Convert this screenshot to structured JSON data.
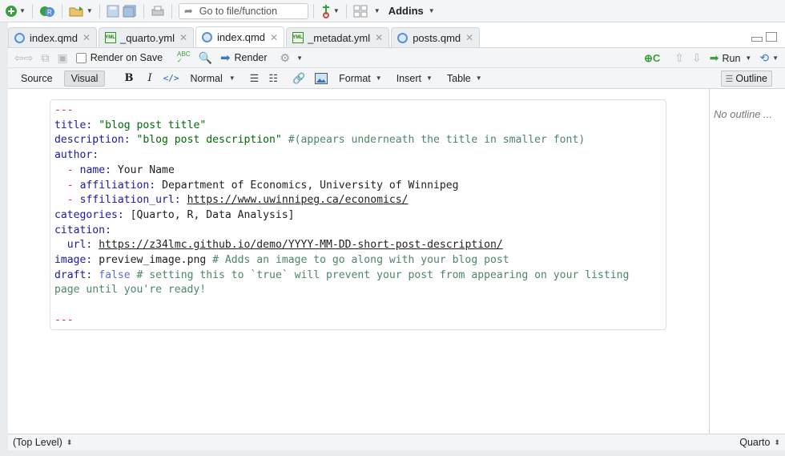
{
  "toolbar": {
    "goto_placeholder": "Go to file/function",
    "addins_label": "Addins"
  },
  "tabs": [
    {
      "label": "index.qmd",
      "icon": "quarto-file-icon",
      "active": false
    },
    {
      "label": "_quarto.yml",
      "icon": "yaml-file-icon",
      "active": false
    },
    {
      "label": "index.qmd",
      "icon": "quarto-file-icon",
      "active": true
    },
    {
      "label": "_metadat.yml",
      "icon": "yaml-file-icon",
      "active": false
    },
    {
      "label": "posts.qmd",
      "icon": "quarto-file-icon",
      "active": false
    }
  ],
  "yaml_icon_text": "YML",
  "editor_toolbar": {
    "render_on_save_label": "Render on Save",
    "render_label": "Render",
    "run_label": "Run"
  },
  "format_toolbar": {
    "source_label": "Source",
    "visual_label": "Visual",
    "bold_label": "B",
    "italic_label": "I",
    "code_label": "</>",
    "style_label": "Normal",
    "format_label": "Format",
    "insert_label": "Insert",
    "table_label": "Table",
    "outline_label": "Outline"
  },
  "yaml": {
    "dashes": "---",
    "title_key": "title:",
    "title_val": "\"blog post title\"",
    "desc_key": "description:",
    "desc_val": "\"blog post description\"",
    "desc_comment": "#(appears underneath the title in smaller font)",
    "author_key": "author:",
    "name_key": "name:",
    "name_val": "Your Name",
    "aff_key": "affiliation:",
    "aff_val": "Department of Economics, University of Winnipeg",
    "affurl_key": "sffiliation_url:",
    "affurl_val": "https://www.uwinnipeg.ca/economics/",
    "cat_key": "categories:",
    "cat_val": "[Quarto, R, Data Analysis]",
    "cit_key": "citation:",
    "url_key": "url:",
    "url_val": "https://z34lmc.github.io/demo/YYYY-MM-DD-short-post-description/",
    "img_key": "image:",
    "img_val": "preview_image.png",
    "img_comment": "# Adds an image to go along with your blog post",
    "draft_key": "draft:",
    "draft_val": "false",
    "draft_comment_1": "# setting this to `true` will prevent your post from appearing on your listing",
    "draft_comment_2": "page until you're ready!"
  },
  "outline_empty": "No outline ...",
  "status": {
    "left": "(Top Level)",
    "right": "Quarto"
  },
  "colors": {
    "key": "#1a1aa6",
    "string": "#036a07",
    "comment": "#4c8669",
    "dash": "#d6248e",
    "boolean": "#5c6bd7"
  }
}
